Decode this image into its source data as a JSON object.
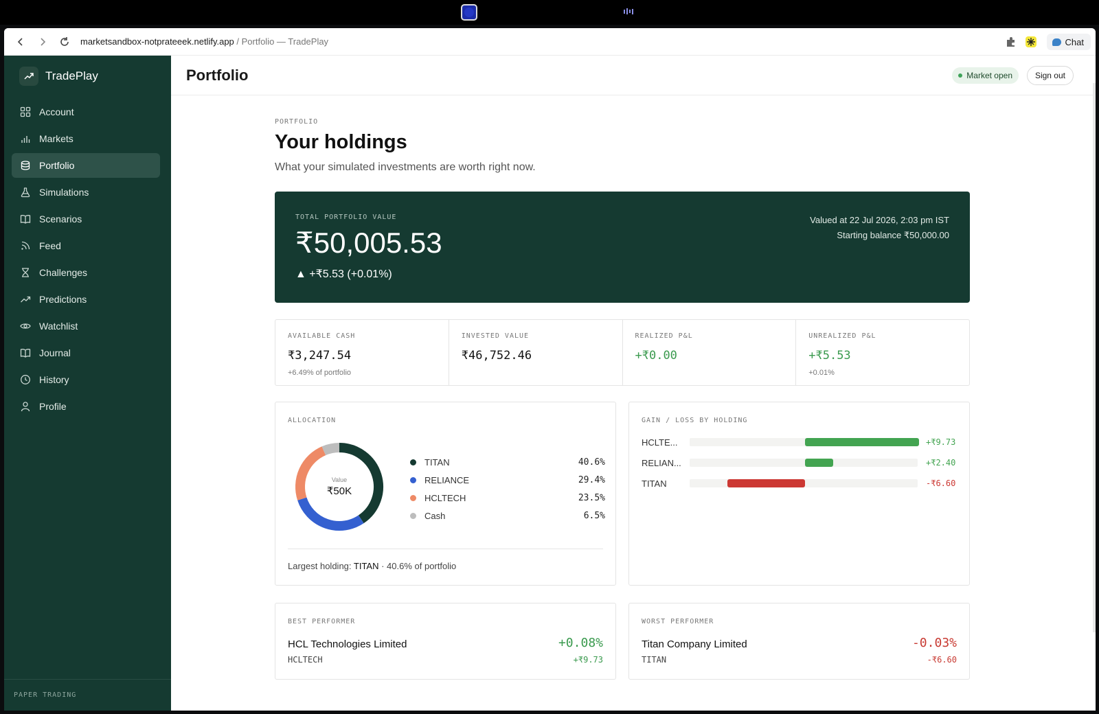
{
  "browser": {
    "url_host": "marketsandbox-notprateeek.netlify.app",
    "url_rest": " / Portfolio — TradePlay",
    "chat_label": "Chat"
  },
  "sidebar": {
    "brand": "TradePlay",
    "items": [
      {
        "label": "Account",
        "icon": "grid-icon"
      },
      {
        "label": "Markets",
        "icon": "bar-chart-icon"
      },
      {
        "label": "Portfolio",
        "icon": "database-icon",
        "active": true
      },
      {
        "label": "Simulations",
        "icon": "flask-icon"
      },
      {
        "label": "Scenarios",
        "icon": "book-open-icon"
      },
      {
        "label": "Feed",
        "icon": "rss-icon"
      },
      {
        "label": "Challenges",
        "icon": "hourglass-icon"
      },
      {
        "label": "Predictions",
        "icon": "trending-up-icon"
      },
      {
        "label": "Watchlist",
        "icon": "eye-icon"
      },
      {
        "label": "Journal",
        "icon": "book-icon"
      },
      {
        "label": "History",
        "icon": "clock-icon"
      },
      {
        "label": "Profile",
        "icon": "user-icon"
      }
    ],
    "footer": "PAPER TRADING"
  },
  "header": {
    "title": "Portfolio",
    "market_status": "Market open",
    "sign_out": "Sign out"
  },
  "intro": {
    "eyebrow": "PORTFOLIO",
    "title": "Your holdings",
    "subtitle": "What your simulated investments are worth right now."
  },
  "hero": {
    "label": "TOTAL PORTFOLIO VALUE",
    "value": "₹50,005.53",
    "change": "▲ +₹5.53  (+0.01%)",
    "valued_at": "Valued at 22 Jul 2026, 2:03 pm IST",
    "starting_balance": "Starting balance ₹50,000.00"
  },
  "stats": [
    {
      "label": "AVAILABLE CASH",
      "value": "₹3,247.54",
      "note": "+6.49% of portfolio"
    },
    {
      "label": "INVESTED VALUE",
      "value": "₹46,752.46",
      "note": ""
    },
    {
      "label": "REALIZED P&L",
      "value": "+₹0.00",
      "note": ""
    },
    {
      "label": "UNREALIZED P&L",
      "value": "+₹5.53",
      "note": "+0.01%"
    }
  ],
  "allocation": {
    "label": "ALLOCATION",
    "center_label": "Value",
    "center_value": "₹50K",
    "items": [
      {
        "name": "TITAN",
        "pct": "40.6%",
        "value": 40.6,
        "color": "#153a31"
      },
      {
        "name": "RELIANCE",
        "pct": "29.4%",
        "value": 29.4,
        "color": "#3460d0"
      },
      {
        "name": "HCLTECH",
        "pct": "23.5%",
        "value": 23.5,
        "color": "#ee8a66"
      },
      {
        "name": "Cash",
        "pct": "6.5%",
        "value": 6.5,
        "color": "#bdbdbd"
      }
    ],
    "footer_prefix": "Largest holding: ",
    "footer_name": "TITAN",
    "footer_suffix": " · 40.6% of portfolio"
  },
  "gain_loss": {
    "label": "GAIN / LOSS BY HOLDING",
    "rows": [
      {
        "name": "HCLTE...",
        "value": 9.73,
        "label": "+₹9.73"
      },
      {
        "name": "RELIAN...",
        "value": 2.4,
        "label": "+₹2.40"
      },
      {
        "name": "TITAN",
        "value": -6.6,
        "label": "-₹6.60"
      }
    ],
    "colors": {
      "positive": "#43a451",
      "negative": "#cc3833"
    }
  },
  "best": {
    "label": "BEST PERFORMER",
    "name": "HCL Technologies Limited",
    "ticker": "HCLTECH",
    "pct": "+0.08%",
    "abs": "+₹9.73"
  },
  "worst": {
    "label": "WORST PERFORMER",
    "name": "Titan Company Limited",
    "ticker": "TITAN",
    "pct": "-0.03%",
    "abs": "-₹6.60"
  }
}
